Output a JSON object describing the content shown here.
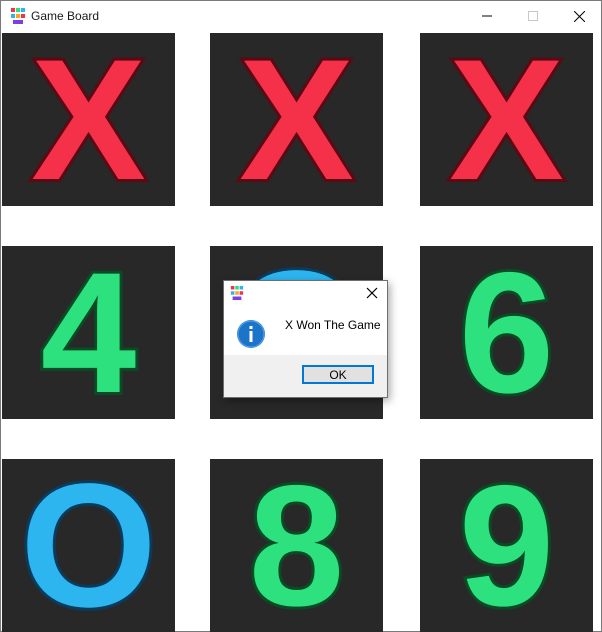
{
  "window": {
    "title": "Game Board",
    "controls": {
      "minimize": "minimize-icon",
      "maximize": "maximize-icon",
      "close": "close-icon"
    }
  },
  "board": {
    "cells": [
      {
        "value": "X",
        "kind": "x"
      },
      {
        "value": "X",
        "kind": "x"
      },
      {
        "value": "X",
        "kind": "x"
      },
      {
        "value": "4",
        "kind": "n"
      },
      {
        "value": "O",
        "kind": "o"
      },
      {
        "value": "6",
        "kind": "n"
      },
      {
        "value": "O",
        "kind": "o"
      },
      {
        "value": "8",
        "kind": "n"
      },
      {
        "value": "9",
        "kind": "n"
      }
    ]
  },
  "dialog": {
    "message": "X Won The Game",
    "ok_label": "OK",
    "icon": "info-icon"
  },
  "colors": {
    "x_mark": "#f5314a",
    "o_mark": "#2cb5ef",
    "number_mark": "#2de27e",
    "cell_background": "#282828",
    "accent": "#0078d7"
  }
}
